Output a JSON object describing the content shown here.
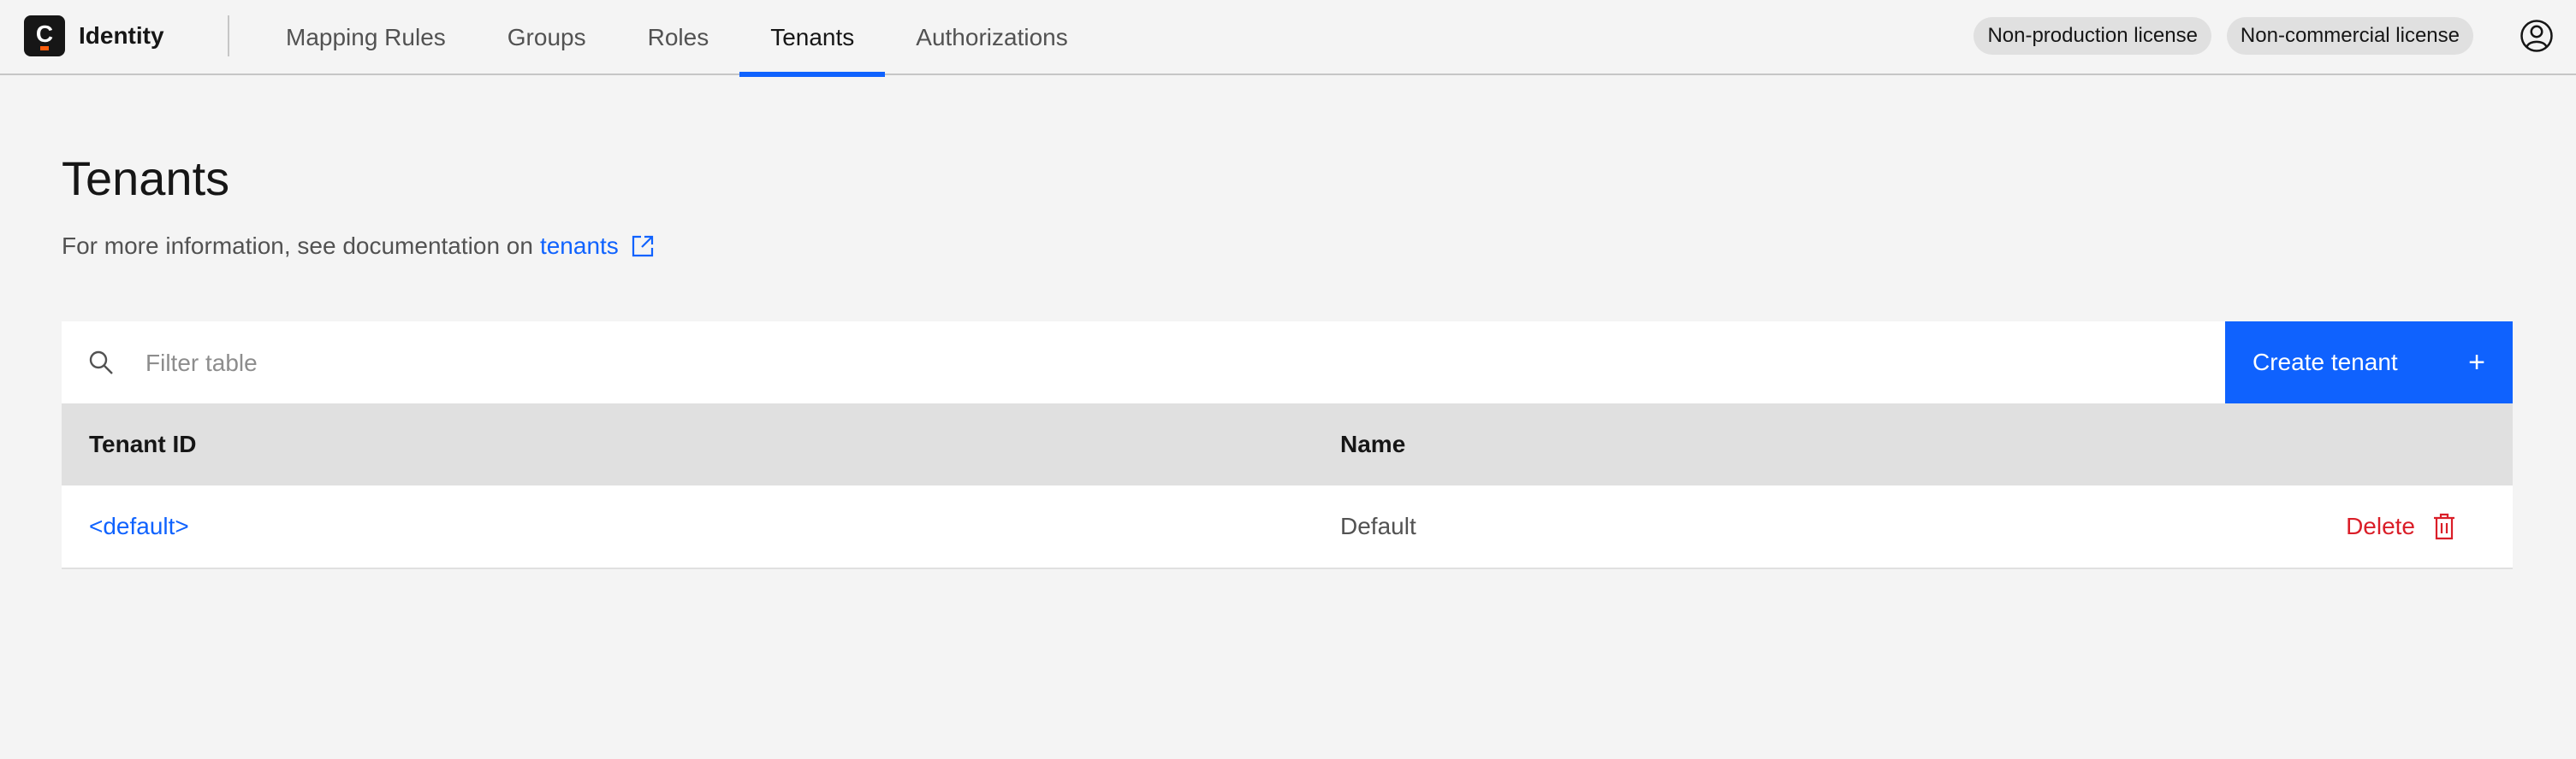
{
  "app": {
    "brand_letter": "C",
    "name": "Identity"
  },
  "nav": {
    "items": [
      {
        "label": "Mapping Rules",
        "active": false
      },
      {
        "label": "Groups",
        "active": false
      },
      {
        "label": "Roles",
        "active": false
      },
      {
        "label": "Tenants",
        "active": true
      },
      {
        "label": "Authorizations",
        "active": false
      }
    ]
  },
  "badges": [
    "Non-production license",
    "Non-commercial license"
  ],
  "page": {
    "title": "Tenants",
    "info_prefix": "For more information, see documentation on",
    "info_link": "tenants"
  },
  "table": {
    "search_placeholder": "Filter table",
    "create_label": "Create tenant",
    "create_icon": "+",
    "columns": [
      "Tenant ID",
      "Name"
    ],
    "rows": [
      {
        "tenant_id": "<default>",
        "name": "Default",
        "action": "Delete"
      }
    ]
  },
  "colors": {
    "accent": "#0f62fe",
    "danger": "#da1e28",
    "brand": "#fc5d0d"
  },
  "icons": [
    "user-avatar-icon",
    "external-link-icon",
    "search-icon",
    "plus-icon",
    "trash-icon"
  ]
}
